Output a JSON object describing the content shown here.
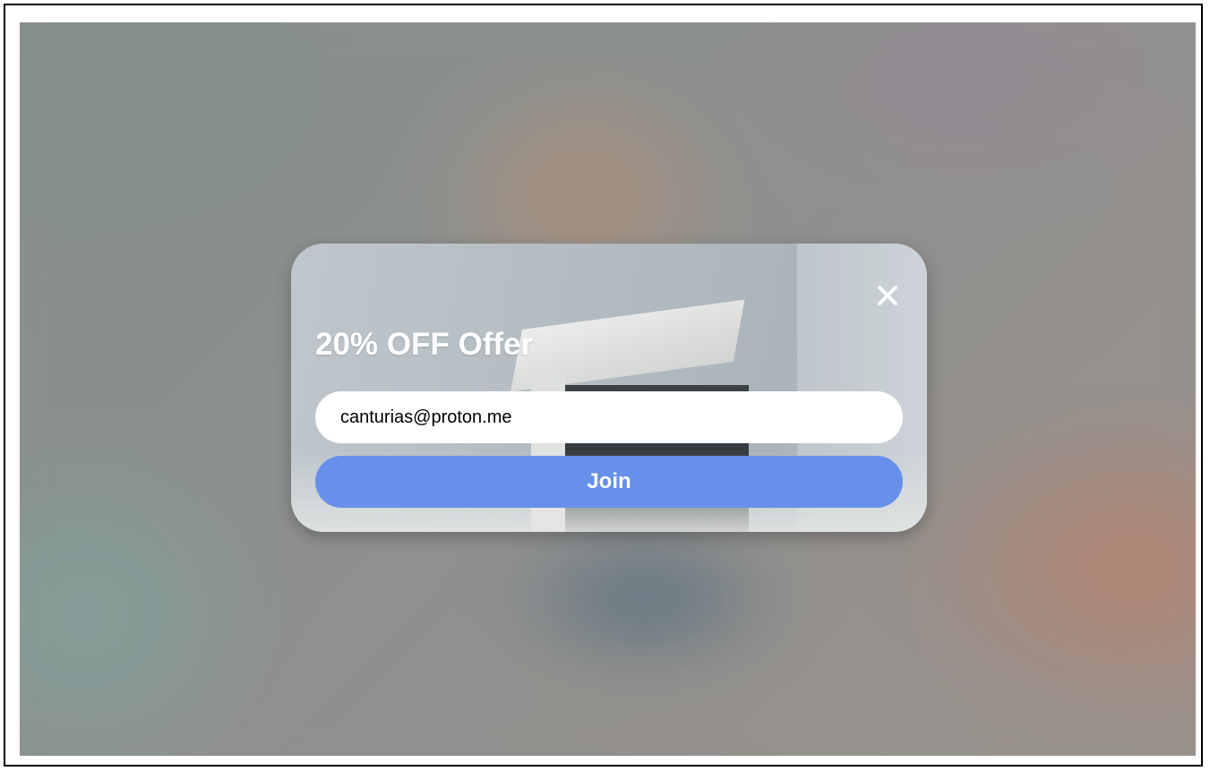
{
  "modal": {
    "title": "20% OFF Offer",
    "close_icon": "close-icon",
    "email_value": "canturias@proton.me",
    "join_label": "Join"
  },
  "colors": {
    "join_button": "#6690ea",
    "input_background": "#ffffff",
    "title_text": "#ffffff"
  }
}
